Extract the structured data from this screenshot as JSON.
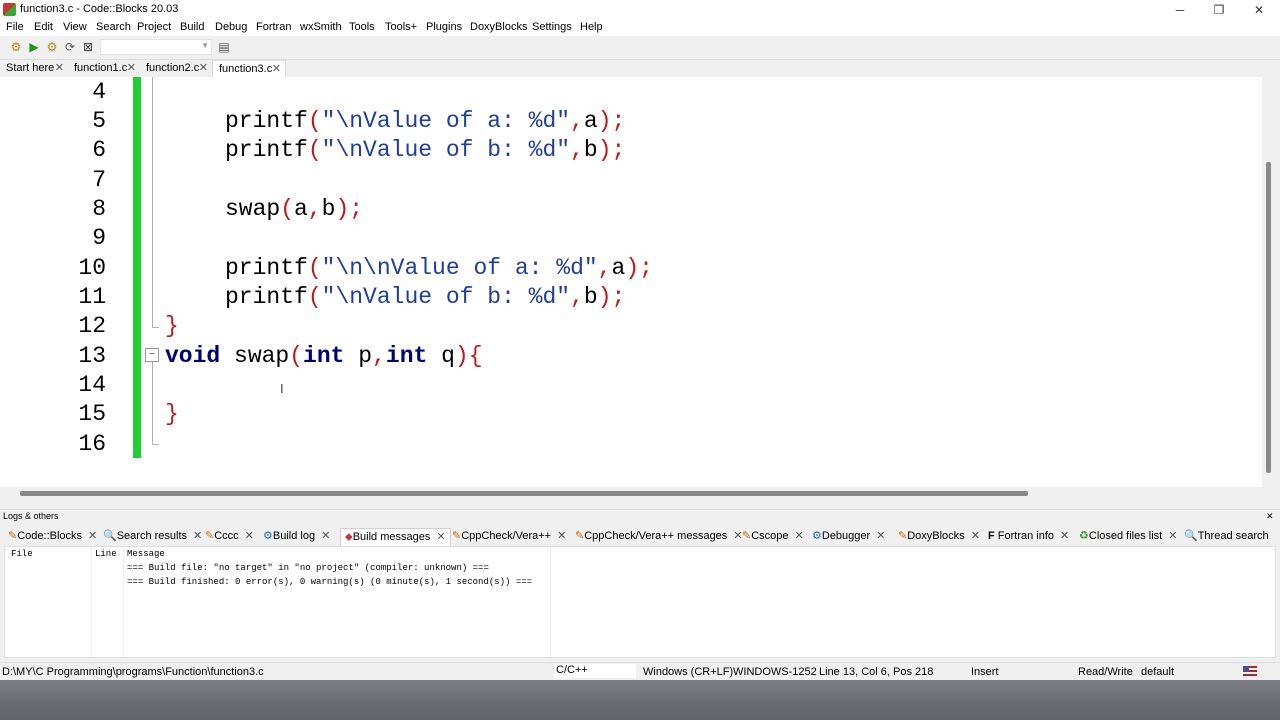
{
  "window": {
    "title": "function3.c - Code::Blocks 20.03",
    "minimize": "─",
    "maximize": "❐",
    "close": "✕"
  },
  "menu": [
    "File",
    "Edit",
    "View",
    "Search",
    "Project",
    "Build",
    "Debug",
    "Fortran",
    "wxSmith",
    "Tools",
    "Tools+",
    "Plugins",
    "DoxyBlocks",
    "Settings",
    "Help"
  ],
  "toolbar": {
    "build_icon": "gear-icon",
    "run_icon": "play-icon",
    "build_run_icon": "gear-play-icon",
    "rebuild_icon": "rebuild-icon",
    "abort_icon": "stop-icon"
  },
  "tabs": [
    {
      "label": "Start here",
      "close": "✕"
    },
    {
      "label": "function1.c",
      "close": "✕"
    },
    {
      "label": "function2.c",
      "close": "✕"
    },
    {
      "label": "function3.c",
      "close": "✕"
    }
  ],
  "editor": {
    "line_numbers": [
      "4",
      "5",
      "6",
      "7",
      "8",
      "9",
      "10",
      "11",
      "12",
      "13",
      "14",
      "15",
      "16"
    ],
    "lines": {
      "l5": {
        "fn": "printf",
        "p1": "(",
        "str": "\"\\nValue of a: %d\"",
        "comma": ",",
        "arg": "a",
        "end": ");"
      },
      "l6": {
        "fn": "printf",
        "p1": "(",
        "str": "\"\\nValue of b: %d\"",
        "comma": ",",
        "arg": "b",
        "end": ");"
      },
      "l8": {
        "fn": "swap",
        "p1": "(",
        "a": "a",
        "comma": ",",
        "b": "b",
        "end": ");"
      },
      "l10": {
        "fn": "printf",
        "p1": "(",
        "str": "\"\\n\\nValue of a: %d\"",
        "comma": ",",
        "arg": "a",
        "end": ");"
      },
      "l11": {
        "fn": "printf",
        "p1": "(",
        "str": "\"\\nValue of b: %d\"",
        "comma": ",",
        "arg": "b",
        "end": ");"
      },
      "l12": {
        "brace": "}"
      },
      "l13": {
        "kw_void": "void",
        "name": " swap",
        "p1": "(",
        "kw_int1": "int",
        "p": " p",
        "comma": ",",
        "kw_int2": "int",
        "q": " q",
        "p2": ")",
        "brace": "{"
      },
      "l15": {
        "brace": "}"
      }
    },
    "cursor_glyph": "I"
  },
  "logs": {
    "header": "Logs & others",
    "close": "✕",
    "tabs": [
      {
        "label": "Code::Blocks"
      },
      {
        "label": "Search results"
      },
      {
        "label": "Cccc"
      },
      {
        "label": "Build log"
      },
      {
        "label": "Build messages"
      },
      {
        "label": "CppCheck/Vera++"
      },
      {
        "label": "CppCheck/Vera++ messages"
      },
      {
        "label": "Cscope"
      },
      {
        "label": "Debugger"
      },
      {
        "label": "DoxyBlocks"
      },
      {
        "label": "Fortran info"
      },
      {
        "label": "Closed files list"
      },
      {
        "label": "Thread search"
      }
    ],
    "columns": [
      "File",
      "Line",
      "Message"
    ],
    "messages": [
      "=== Build file: \"no target\" in \"no project\" (compiler: unknown) ===",
      "=== Build finished: 0 error(s), 0 warning(s) (0 minute(s), 1 second(s)) ==="
    ]
  },
  "status": {
    "path": "D:\\MY\\C Programming\\programs\\Function\\function3.c",
    "language": "C/C++",
    "eol": "Windows (CR+LF)",
    "encoding": "WINDOWS-1252",
    "position": "Line 13, Col 6, Pos 218",
    "mode": "Insert",
    "access": "Read/Write",
    "profile": "default"
  },
  "colors": {
    "change_bar": "#22cc33",
    "keyword": "#00007b",
    "string": "#1d3da0",
    "operator": "#c21717"
  }
}
